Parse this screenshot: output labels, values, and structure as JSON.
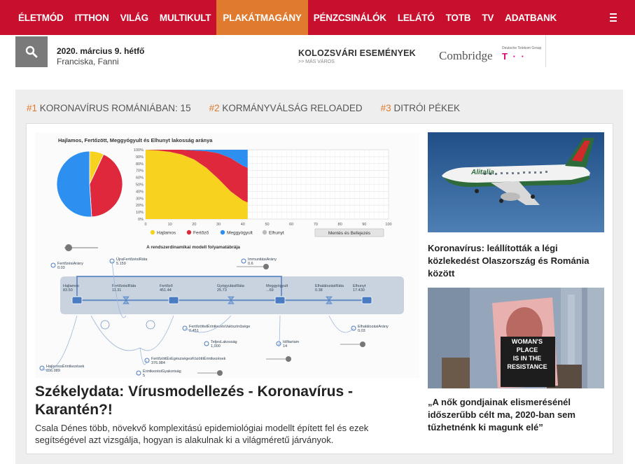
{
  "nav": {
    "items": [
      {
        "label": "ÉLETMÓD",
        "active": false
      },
      {
        "label": "ITTHON",
        "active": false
      },
      {
        "label": "VILÁG",
        "active": false
      },
      {
        "label": "MULTIKULT",
        "active": false
      },
      {
        "label": "PLAKÁTMAGÁNY",
        "active": true
      },
      {
        "label": "PÉNZCSINÁLÓK",
        "active": false
      },
      {
        "label": "LELÁTÓ",
        "active": false
      },
      {
        "label": "TOTB",
        "active": false
      },
      {
        "label": "TV",
        "active": false
      },
      {
        "label": "ADATBANK",
        "active": false
      }
    ],
    "menu_icon": "hamburger-icon",
    "colors": {
      "bar": "#c8102e",
      "active": "#e07a2e"
    }
  },
  "subbar": {
    "search_icon": "search-icon",
    "date": "2020. március 9. hétfő",
    "names": "Franciska, Fanni",
    "events_title": "KOLOZSVÁRI ESEMÉNYEK",
    "events_link": ">> MÁS VÁROS",
    "sponsor1": "Combridge",
    "sponsor2_tagline": "Deutsche Telekom Group",
    "sponsor2_mark": "T · ·"
  },
  "trending": [
    {
      "num": "#1",
      "label": "KORONAVÍRUS ROMÁNIÁBAN: 15"
    },
    {
      "num": "#2",
      "label": "KORMÁNYVÁLSÁG RELOADED"
    },
    {
      "num": "#3",
      "label": "DITRÓI PÉKEK"
    }
  ],
  "main": {
    "headline": "Székelydata: Vírusmodellezés - Koronavírus - Karantén?!",
    "lead": "Csala Dénes több, növekvő komplexitású epidemiológiai modellt épített fel és ezek segítségével azt vizsgálja, hogyan is alakulnak ki a világméretű járványok.",
    "figure": {
      "title": "Hajlamos, Fertőzött, Meggyógyult és Elhunyt lakosság aránya",
      "legend": [
        "Hajlamos",
        "Fertőző",
        "Meggyógyult",
        "Elhunyt"
      ],
      "save_button": "Mentés és Befejezés",
      "diagram_title": "A rendszerdinamikai modell folyamatábrája",
      "stocks": [
        {
          "name": "Hajlamos",
          "value": "83.50"
        },
        {
          "name": "FertőzésiRáta",
          "value": "11.31"
        },
        {
          "name": "Fertőző",
          "value": "451.44"
        },
        {
          "name": "GyógyulásiRáta",
          "value": "25.73"
        },
        {
          "name": "Meggyógyult",
          "value": "...69"
        },
        {
          "name": "ElhalálozásiRáta",
          "value": "0.38"
        },
        {
          "name": "Elhunyt",
          "value": "17.430"
        }
      ],
      "params": [
        {
          "name": "FertőzésiArány",
          "value": "0.03"
        },
        {
          "name": "ÚjraFertőzésiRáta",
          "value": "5.159"
        },
        {
          "name": "ImmunitásiArány",
          "value": "0.6"
        },
        {
          "name": "FertőzöttelÉrintkezésValószínűsége",
          "value": "0.451"
        },
        {
          "name": "TeljesLakosság",
          "value": "1,000"
        },
        {
          "name": "Időtartam",
          "value": "14"
        },
        {
          "name": "ElhalálozásiArány",
          "value": "0.03"
        },
        {
          "name": "FertőzöttÉsEgészségesKözöttiÉrintkezések",
          "value": "376.984"
        },
        {
          "name": "HajlamosÉrintkezések",
          "value": "836.089"
        },
        {
          "name": "ÉrintkezésiGyakoriság",
          "value": "5"
        }
      ],
      "colors": {
        "susceptible": "#f7d21e",
        "infected": "#e0283c",
        "recovered": "#2d8ff0",
        "deceased": "#bbbbbb"
      }
    }
  },
  "side": [
    {
      "headline": "Koronavírus: leállították a légi közlekedést Olaszország és Románia között",
      "image": "airplane-photo",
      "airline_text": "Alitalia"
    },
    {
      "headline": "„A nők gondjainak elismerésénél időszerűbb célt ma, 2020-ban sem tűzhetnénk ki magunk elé”",
      "image": "protest-sign-photo",
      "sign_text": [
        "WOMAN'S",
        "PLACE",
        "IS IN THE",
        "RESISTANCE"
      ]
    }
  ],
  "chart_data": {
    "type": "area",
    "title": "Hajlamos, Fertőzött, Meggyógyult és Elhunyt lakosság aránya",
    "x": [
      0,
      10,
      20,
      30,
      40,
      50,
      60,
      70,
      80,
      90,
      100
    ],
    "xlim": [
      0,
      100
    ],
    "ylim": [
      0,
      100
    ],
    "yticks": [
      "0%",
      "10%",
      "20%",
      "30%",
      "40%",
      "50%",
      "60%",
      "70%",
      "80%",
      "90%",
      "100%"
    ],
    "series": [
      {
        "name": "Hajlamos",
        "x": [
          0,
          5,
          10,
          15,
          20,
          25,
          30,
          35,
          40,
          42
        ],
        "values": [
          100,
          99,
          97,
          93,
          86,
          74,
          58,
          40,
          27,
          24
        ]
      },
      {
        "name": "Fertőző",
        "x": [
          0,
          5,
          10,
          15,
          20,
          25,
          30,
          35,
          40,
          42
        ],
        "values": [
          0,
          1,
          3,
          7,
          13,
          24,
          37,
          48,
          50,
          50
        ]
      },
      {
        "name": "Meggyógyult",
        "x": [
          0,
          5,
          10,
          15,
          20,
          25,
          30,
          35,
          40,
          42
        ],
        "values": [
          0,
          0,
          0,
          0,
          1,
          2,
          5,
          12,
          23,
          26
        ]
      },
      {
        "name": "Elhunyt",
        "x": [
          0,
          42
        ],
        "values": [
          0,
          0
        ]
      }
    ],
    "pie": {
      "labels": [
        "Hajlamos",
        "Fertőző",
        "Meggyógyult",
        "Elhunyt"
      ],
      "values": [
        7,
        42,
        51,
        0
      ]
    },
    "grid": true,
    "legend": "bottom"
  }
}
